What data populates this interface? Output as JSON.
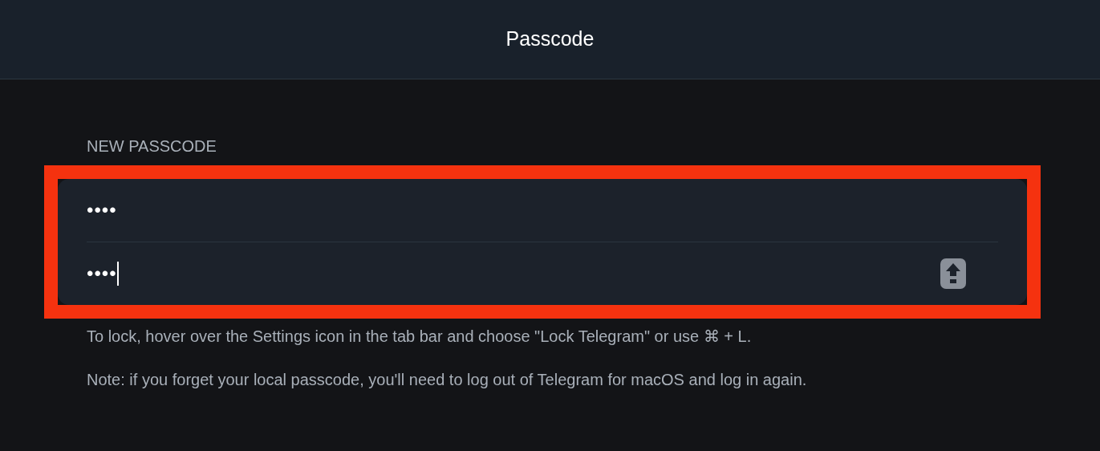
{
  "window": {
    "title": "Passcode"
  },
  "section_label": "NEW PASSCODE",
  "fields": [
    {
      "value": "••••",
      "focused": false,
      "caps_lock": false
    },
    {
      "value": "••••",
      "focused": true,
      "caps_lock": true
    }
  ],
  "notes": [
    "To lock, hover over the Settings icon in the tab bar and choose \"Lock Telegram\" or use ⌘ + L.",
    "Note: if you forget your local passcode, you'll need to log out of Telegram for macOS and log in again."
  ]
}
